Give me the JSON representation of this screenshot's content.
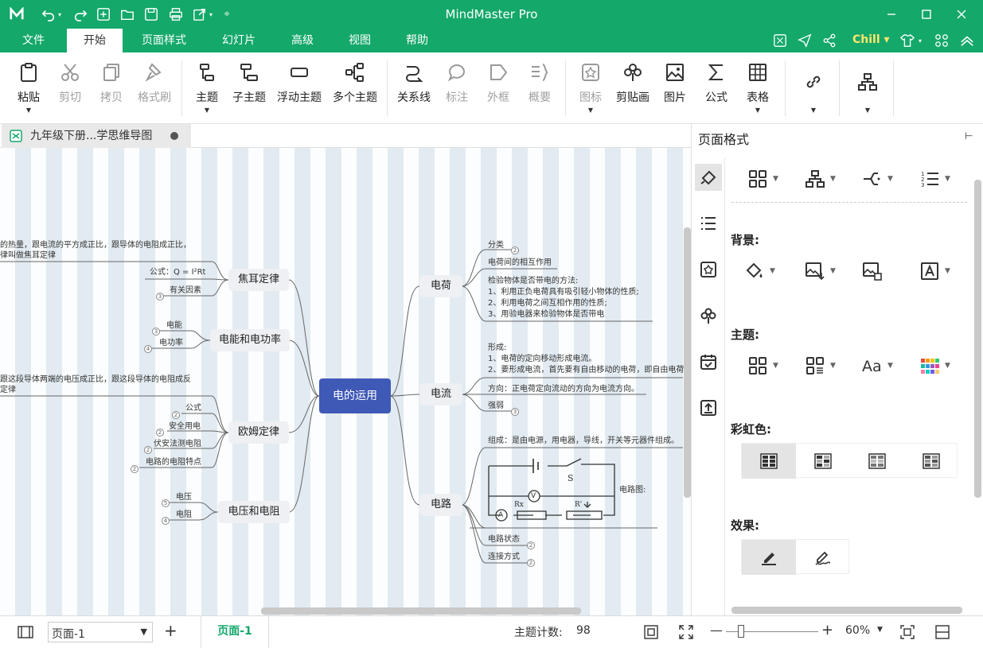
{
  "window": {
    "title": "MindMaster Pro"
  },
  "menu": {
    "tabs": [
      "文件",
      "开始",
      "页面样式",
      "幻灯片",
      "高级",
      "视图",
      "帮助"
    ],
    "chill": "Chill"
  },
  "ribbon": {
    "buttons": [
      {
        "label": "粘贴",
        "icon": "clipboard-icon"
      },
      {
        "label": "剪切",
        "icon": "scissors-icon"
      },
      {
        "label": "拷贝",
        "icon": "copy-icon"
      },
      {
        "label": "格式刷",
        "icon": "format-brush-icon"
      },
      {
        "label": "主题",
        "icon": "topic-icon"
      },
      {
        "label": "子主题",
        "icon": "subtopic-icon"
      },
      {
        "label": "浮动主题",
        "icon": "floating-topic-icon"
      },
      {
        "label": "多个主题",
        "icon": "multiple-topics-icon"
      },
      {
        "label": "关系线",
        "icon": "relationship-icon"
      },
      {
        "label": "标注",
        "icon": "callout-icon"
      },
      {
        "label": "外框",
        "icon": "boundary-icon"
      },
      {
        "label": "概要",
        "icon": "summary-icon"
      },
      {
        "label": "图标",
        "icon": "mark-icon"
      },
      {
        "label": "剪贴画",
        "icon": "clipart-icon"
      },
      {
        "label": "图片",
        "icon": "picture-icon"
      },
      {
        "label": "公式",
        "icon": "formula-icon"
      },
      {
        "label": "表格",
        "icon": "table-icon"
      }
    ]
  },
  "doc": {
    "tab": "九年级下册...学思维导图"
  },
  "panel": {
    "title": "页面格式",
    "background": "背景:",
    "theme": "主题:",
    "rainbow": "彩虹色:",
    "effect": "效果:"
  },
  "map": {
    "center": "电的运用",
    "topics": {
      "charge": "电荷",
      "current": "电流",
      "circuit": "电路",
      "joule": "焦耳定律",
      "power": "电能和电功率",
      "ohm": "欧姆定律",
      "voltage": "电压和电阻"
    },
    "charge": {
      "classify": "分类",
      "interact": "电荷间的相互作用",
      "method": "检验物体是否带电的方法:",
      "m1": "1、利用正负电荷具有吸引轻小物体的性质;",
      "m2": "2、利用电荷之间互相作用的性质;",
      "m3": "3、用验电器来检验物体是否带电"
    },
    "current": {
      "form": "形成:",
      "f1": "1、电荷的定向移动形成电流。",
      "f2": "2、要形成电流，首先要有自由移动的电荷，即自由电荷",
      "dir": "方向：正电荷定向流动的方向为电流方向。",
      "strength": "强弱"
    },
    "circuit": {
      "compose": "组成：是由电源，用电器，导线，开关等元器件组成。",
      "diagram": "电路图:",
      "s": "S",
      "rx": "Rx",
      "rp": "R'",
      "a": "A",
      "v": "V",
      "state": "电路状态",
      "connect": "连接方式"
    },
    "joule": {
      "d1": "的热量，跟电流的平方成正比，跟导体的电阻成正比，",
      "d2": "律叫做焦耳定律",
      "formula": "公式：Q = I²Rt",
      "factor": "有关因素"
    },
    "power": {
      "energy": "电能",
      "work": "电功率"
    },
    "ohm": {
      "d1": "跟这段导体两端的电压成正比，跟这段导体的电阻成反",
      "d2": "定律",
      "formula": "公式",
      "safe": "安全用电",
      "measure": "伏安法测电阻",
      "feature": "电路的电阻特点"
    },
    "voltage": {
      "v": "电压",
      "r": "电阻"
    },
    "badges": {
      "b2": "2",
      "b3": "3",
      "b4": "4",
      "b5": "5"
    }
  },
  "status": {
    "page_select": "页面-1",
    "page_tab": "页面-1",
    "count_label": "主题计数:",
    "count": "98",
    "zoom": "60%"
  }
}
